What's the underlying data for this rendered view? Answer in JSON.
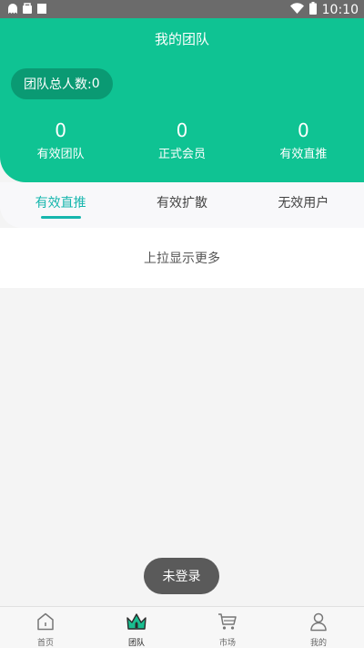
{
  "status_bar": {
    "time": "10:10"
  },
  "header": {
    "title": "我的团队",
    "total_label": "团队总人数:",
    "total_value": "0"
  },
  "stats": [
    {
      "value": "0",
      "label": "有效团队"
    },
    {
      "value": "0",
      "label": "正式会员"
    },
    {
      "value": "0",
      "label": "有效直推"
    }
  ],
  "tabs": [
    {
      "label": "有效直推",
      "active": true
    },
    {
      "label": "有效扩散",
      "active": false
    },
    {
      "label": "无效用户",
      "active": false
    }
  ],
  "list": {
    "load_more": "上拉显示更多"
  },
  "toast": {
    "text": "未登录"
  },
  "bottom_nav": [
    {
      "label": "首页",
      "icon": "home-icon"
    },
    {
      "label": "团队",
      "icon": "team-icon",
      "active": true
    },
    {
      "label": "市场",
      "icon": "cart-icon"
    },
    {
      "label": "我的",
      "icon": "user-icon"
    }
  ],
  "colors": {
    "accent": "#0fc393",
    "tab_active": "#16b6ad"
  }
}
